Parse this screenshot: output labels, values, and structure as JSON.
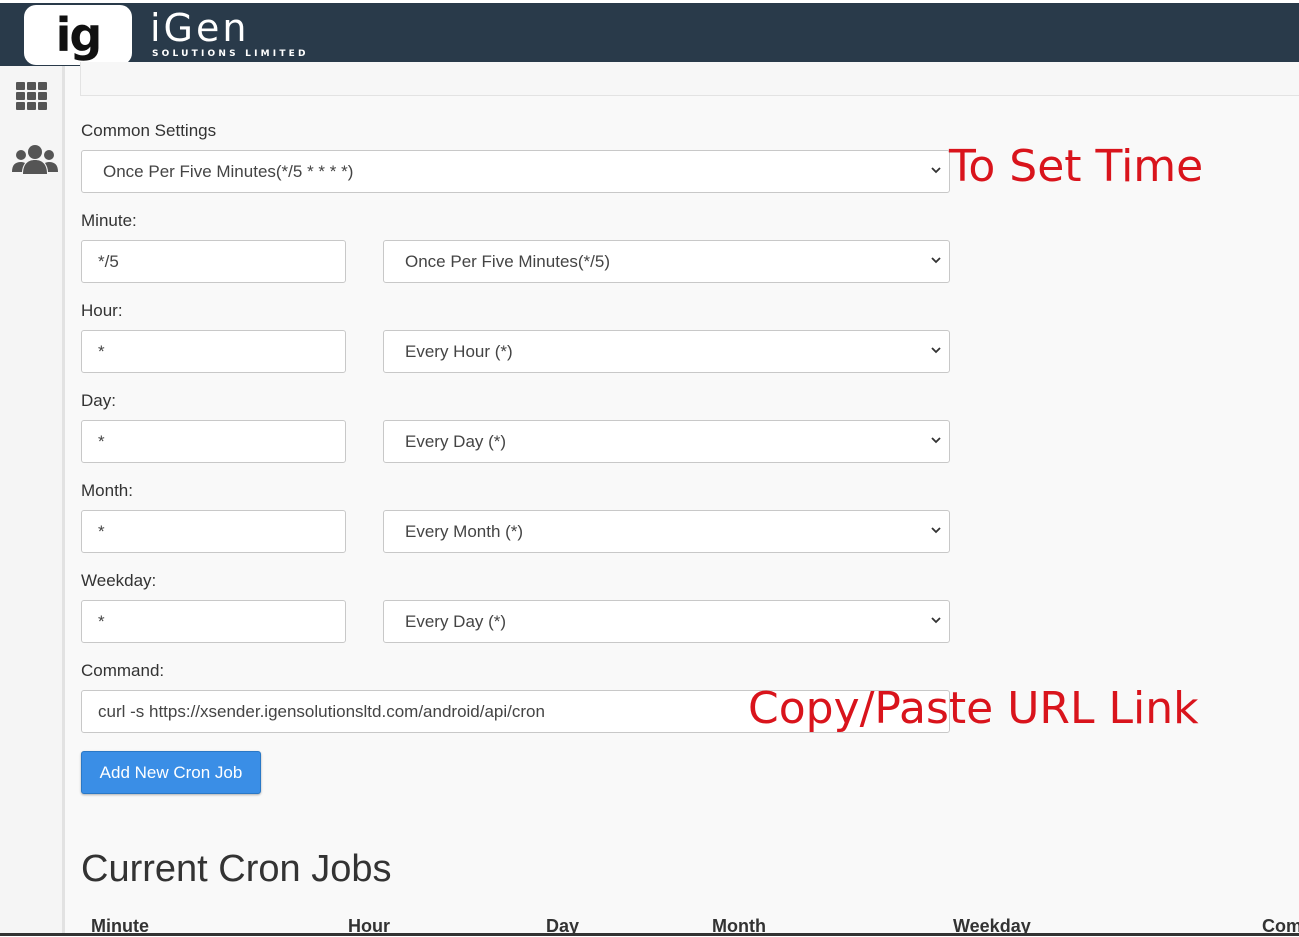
{
  "brand": {
    "badge": "ig",
    "name": "iGen",
    "tagline": "SOLUTIONS LIMITED"
  },
  "sidebar": {
    "items": [
      {
        "icon": "grid-icon"
      },
      {
        "icon": "users-icon"
      }
    ]
  },
  "form": {
    "common_settings_label": "Common Settings",
    "common_settings_value": "Once Per Five Minutes(*/5 * * * *)",
    "minute": {
      "label": "Minute:",
      "value": "*/5",
      "select": "Once Per Five Minutes(*/5)"
    },
    "hour": {
      "label": "Hour:",
      "value": "*",
      "select": "Every Hour (*)"
    },
    "day": {
      "label": "Day:",
      "value": "*",
      "select": "Every Day (*)"
    },
    "month": {
      "label": "Month:",
      "value": "*",
      "select": "Every Month (*)"
    },
    "weekday": {
      "label": "Weekday:",
      "value": "*",
      "select": "Every Day (*)"
    },
    "command": {
      "label": "Command:",
      "value": "curl -s https://xsender.igensolutionsltd.com/android/api/cron"
    },
    "submit_label": "Add New Cron Job"
  },
  "annotations": {
    "time": "To Set Time",
    "url": "Copy/Paste URL Link"
  },
  "current_jobs": {
    "title": "Current Cron Jobs",
    "columns": [
      "Minute",
      "Hour",
      "Day",
      "Month",
      "Weekday",
      "Com"
    ]
  },
  "colors": {
    "topbar": "#293a4a",
    "button": "#3a8ee6",
    "annotation": "#d9141c"
  }
}
